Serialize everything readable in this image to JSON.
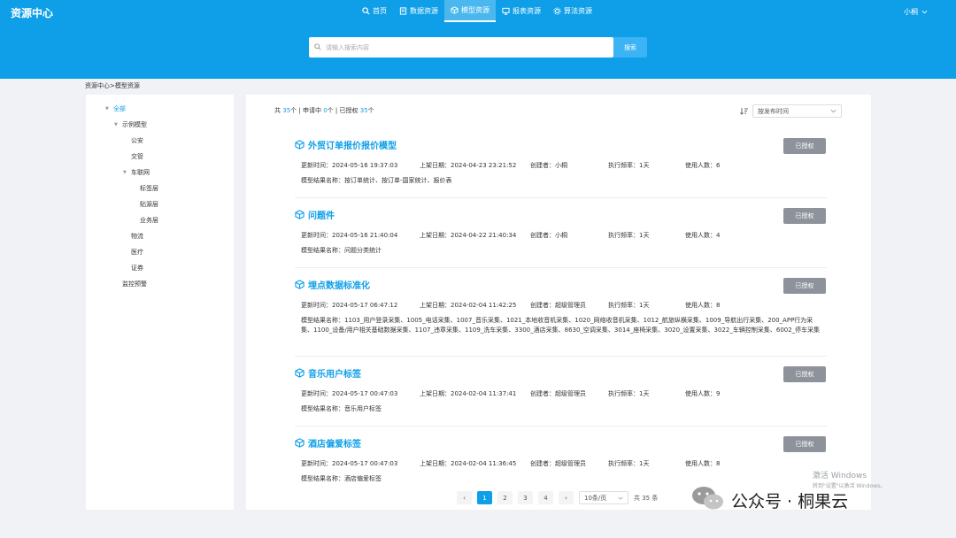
{
  "app": {
    "title": "资源中心"
  },
  "nav": {
    "items": [
      {
        "label": "首页",
        "icon": "search-icon"
      },
      {
        "label": "数据资源",
        "icon": "document-icon"
      },
      {
        "label": "模型资源",
        "icon": "cube-icon",
        "active": true
      },
      {
        "label": "报表资源",
        "icon": "monitor-icon"
      },
      {
        "label": "算法资源",
        "icon": "gear-icon"
      }
    ]
  },
  "user": {
    "name": "小桐"
  },
  "search": {
    "placeholder": "请输入搜索内容",
    "value": "",
    "button_label": "搜索"
  },
  "breadcrumb": "资源中心>模型资源",
  "tree": {
    "items": [
      {
        "label": "全部"
      },
      {
        "label": "示例模型"
      },
      {
        "label": "公安"
      },
      {
        "label": "交管"
      },
      {
        "label": "车联网"
      },
      {
        "label": "标签层"
      },
      {
        "label": "贴源层"
      },
      {
        "label": "业务层"
      },
      {
        "label": "物流"
      },
      {
        "label": "医疗"
      },
      {
        "label": "证券"
      },
      {
        "label": "监控预警"
      }
    ]
  },
  "summary": {
    "total_prefix": "共 ",
    "total": "35",
    "total_suffix": "个 | 申请中 ",
    "applying": "0",
    "applying_suffix": "个 | 已授权 ",
    "authorized": "35",
    "authorized_suffix": "个"
  },
  "sort": {
    "selected": "按发布时间"
  },
  "labels": {
    "updated": "更新时间：",
    "listed": "上架日期：",
    "creator": "创建者：",
    "frequency": "执行频率：",
    "users": "使用人数：",
    "result": "模型结果名称：",
    "authorized_button": "已授权"
  },
  "models": [
    {
      "title": "外贸订单报价报价模型",
      "updated": "2024-05-16 19:37:03",
      "listed": "2024-04-23 23:21:52",
      "creator": "小桐",
      "frequency": "1天",
      "users": "6",
      "result": "按订单统计、按订单-国家统计、报价表"
    },
    {
      "title": "问题件",
      "updated": "2024-05-16 21:40:04",
      "listed": "2024-04-22 21:40:34",
      "creator": "小桐",
      "frequency": "1天",
      "users": "4",
      "result": "问题分类统计"
    },
    {
      "title": "埋点数据标准化",
      "updated": "2024-05-17 06:47:12",
      "listed": "2024-02-04 11:42:25",
      "creator": "超级管理员",
      "frequency": "1天",
      "users": "8",
      "result": "1103_用户登录采集、1005_电话采集、1007_音乐采集、1021_本地收音机采集、1020_网络收音机采集、1012_航旅纵横采集、1009_导航出行采集、200_APP行为采集、1100_设备/用户相关基础数据采集、1107_违章采集、1109_洗车采集、3300_酒店采集、8630_空调采集、3014_座椅采集、3020_设置采集、3022_车辆控制采集、6002_停车采集"
    },
    {
      "title": "音乐用户标签",
      "updated": "2024-05-17 00:47:03",
      "listed": "2024-02-04 11:37:41",
      "creator": "超级管理员",
      "frequency": "1天",
      "users": "9",
      "result": "音乐用户标签"
    },
    {
      "title": "酒店偏爱标签",
      "updated": "2024-05-17 00:47:03",
      "listed": "2024-02-04 11:36:45",
      "creator": "超级管理员",
      "frequency": "1天",
      "users": "8",
      "result": "酒店偏爱标签"
    }
  ],
  "pagination": {
    "prev": "‹",
    "next": "›",
    "pages": [
      "1",
      "2",
      "3",
      "4"
    ],
    "current": "1",
    "page_size": "10条/页",
    "total_text": "共 35 条"
  },
  "watermark": {
    "line1": "激活 Windows",
    "line2": "转到\"设置\"以激活 Windows。"
  },
  "brand": {
    "text": "公众号 · 桐果云"
  }
}
